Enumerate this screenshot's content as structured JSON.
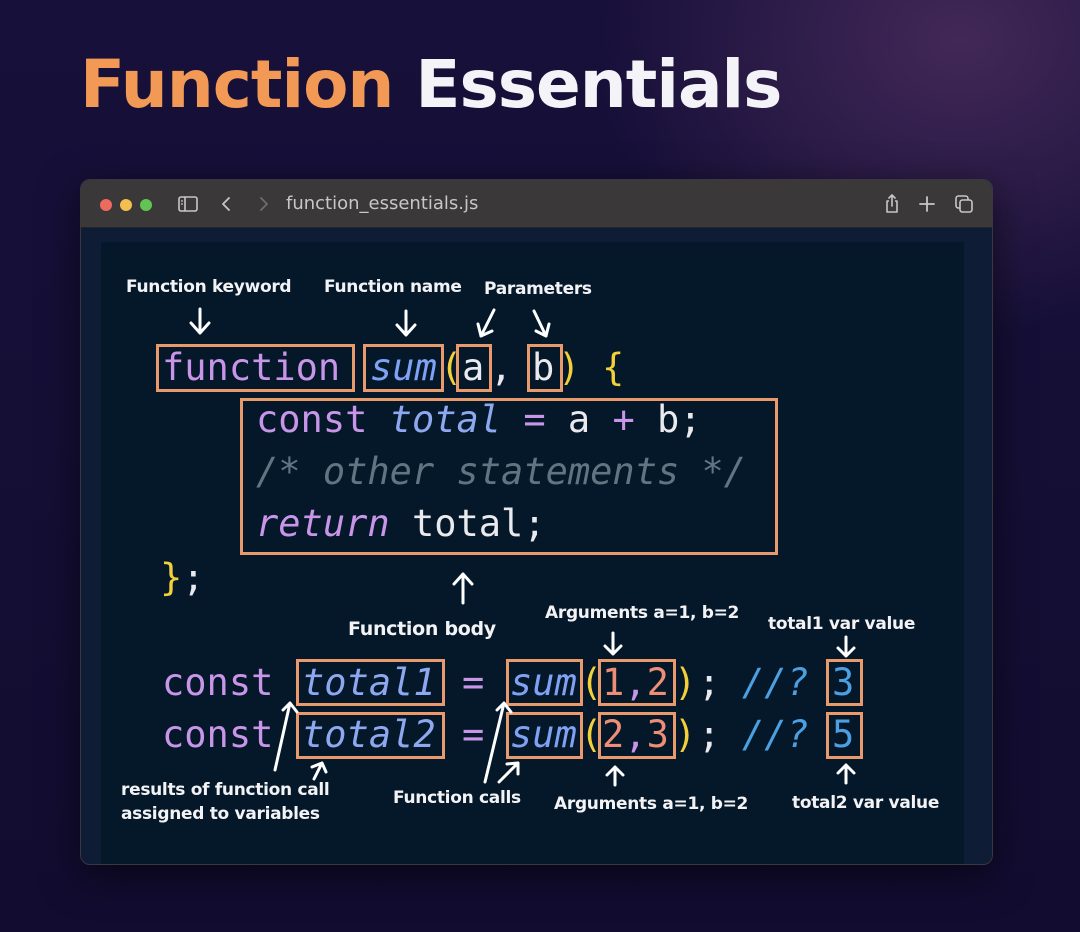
{
  "page": {
    "title_part1": "Function",
    "title_part2": "Essentials",
    "accent_color": "#f29a55"
  },
  "window": {
    "filename": "function_essentials.js",
    "traffic_lights": [
      "close",
      "minimize",
      "zoom"
    ],
    "toolbar_icons": {
      "sidebar": "sidebar-icon",
      "back": "chevron-left-icon",
      "forward": "chevron-right-icon",
      "share": "share-icon",
      "new_tab": "plus-icon",
      "tabs": "tabs-overview-icon"
    }
  },
  "code": {
    "line1": {
      "keyword": "function",
      "name": "sum",
      "open_paren": "(",
      "param_a": "a",
      "comma": ",",
      "param_b": "b",
      "close_paren": ")",
      "brace": "{"
    },
    "line2": {
      "keyword": "const",
      "var": "total",
      "eq": "=",
      "a": "a",
      "plus": "+",
      "b": "b;"
    },
    "line3": {
      "comment": "/* other statements */"
    },
    "line4": {
      "keyword": "return",
      "value": "total;"
    },
    "line5": {
      "brace": "}",
      "semi": ";"
    },
    "call1": {
      "keyword": "const",
      "var": "total1",
      "eq": "=",
      "fn": "sum",
      "open": "(",
      "arg1": "1",
      "comma": ",",
      "arg2": "2",
      "close": ")",
      "semi": ";",
      "quokka": "//?",
      "result": "3"
    },
    "call2": {
      "keyword": "const",
      "var": "total2",
      "eq": "=",
      "fn": "sum",
      "open": "(",
      "arg1": "2",
      "comma": ",",
      "arg2": "3",
      "close": ")",
      "semi": ";",
      "quokka": "//?",
      "result": "5"
    }
  },
  "annotations": {
    "function_keyword": "Function keyword",
    "function_name": "Function name",
    "parameters": "Parameters",
    "function_body": "Function body",
    "arguments_top": "Arguments a=1, b=2",
    "total1_value": "total1 var value",
    "results_line1": "results of function call",
    "results_line2": "assigned  to variables",
    "function_calls": "Function calls",
    "arguments_bottom": "Arguments a=1, b=2",
    "total2_value": "total2 var value"
  }
}
